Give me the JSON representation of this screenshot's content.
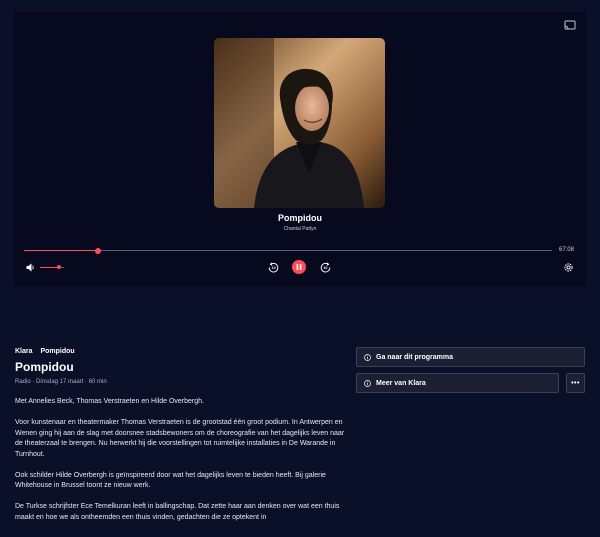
{
  "player": {
    "track_title": "Pompidou",
    "track_subtitle": "Chantal Pattyn",
    "time": "67:08",
    "progress": 0.14,
    "volume": 0.8
  },
  "episode": {
    "breadcrumb": [
      "Klara",
      "Pompidou"
    ],
    "title": "Pompidou",
    "info": "Radio · Dinsdag 17 maart · 60 min",
    "paragraphs": [
      "Met Annelies Beck, Thomas Verstraeten en Hilde Overbergh.",
      "Voor kunstenaar en theatermaker Thomas Verstraeten is de grootstad één groot podium. In Antwerpen en Wenen ging hij aan de slag met doorsnee stadsbewoners om de choreografie van het dagelijks leven naar de theaterzaal te brengen. Nu herwerkt hij die voorstellingen tot ruimtelijke installaties in De Warande in Turnhout.",
      "Ook schilder Hilde Overbergh is geïnspireerd door wat het dagelijks leven te bieden heeft. Bij galerie Whitehouse in Brussel toont ze nieuw werk.",
      "De Turkse schrijfster Ece Temelkuran leeft in ballingschap. Dat zette haar aan denken over wat een thuis maakt en hoe we als ontheemden een thuis vinden, gedachten die ze optekent in"
    ]
  },
  "actions": {
    "goto_program": "Ga naar dit programma",
    "more_from": "Meer van Klara",
    "more_options": "•••"
  },
  "colors": {
    "accent": "#ff4c55",
    "background": "#0b1029",
    "player_bg": "#070a1e"
  }
}
